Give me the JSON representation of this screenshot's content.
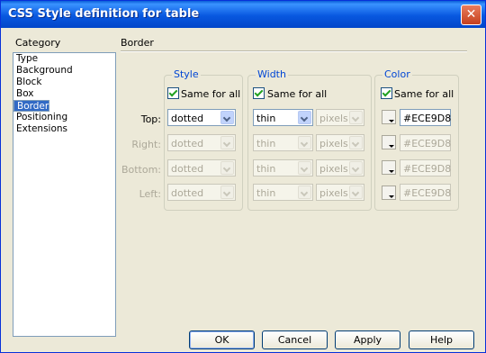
{
  "window": {
    "title": "CSS Style definition for table",
    "close_label": "✕"
  },
  "category": {
    "label": "Category",
    "items": [
      "Type",
      "Background",
      "Block",
      "Box",
      "Border",
      "List",
      "Positioning",
      "Extensions"
    ],
    "selected": "Border"
  },
  "section": {
    "title": "Border"
  },
  "style_group": {
    "label": "Style",
    "same_for_all": "Same for all",
    "checked": true
  },
  "width_group": {
    "label": "Width",
    "same_for_all": "Same for all",
    "checked": true
  },
  "color_group": {
    "label": "Color",
    "same_for_all": "Same for all",
    "checked": true
  },
  "rows": [
    {
      "label": "Top:",
      "style": "dotted",
      "width": "thin",
      "unit": "pixels",
      "color": "#ECE9D8",
      "enabled": true
    },
    {
      "label": "Right:",
      "style": "dotted",
      "width": "thin",
      "unit": "pixels",
      "color": "#ECE9D8",
      "enabled": false
    },
    {
      "label": "Bottom:",
      "style": "dotted",
      "width": "thin",
      "unit": "pixels",
      "color": "#ECE9D8",
      "enabled": false
    },
    {
      "label": "Left:",
      "style": "dotted",
      "width": "thin",
      "unit": "pixels",
      "color": "#ECE9D8",
      "enabled": false
    }
  ],
  "buttons": {
    "ok": "OK",
    "cancel": "Cancel",
    "apply": "Apply",
    "help": "Help"
  },
  "icons": {
    "close": "close-icon",
    "checkbox": "checkmark-icon",
    "dropdown": "chevron-down-icon",
    "color_swatch": "color-picker-icon"
  }
}
